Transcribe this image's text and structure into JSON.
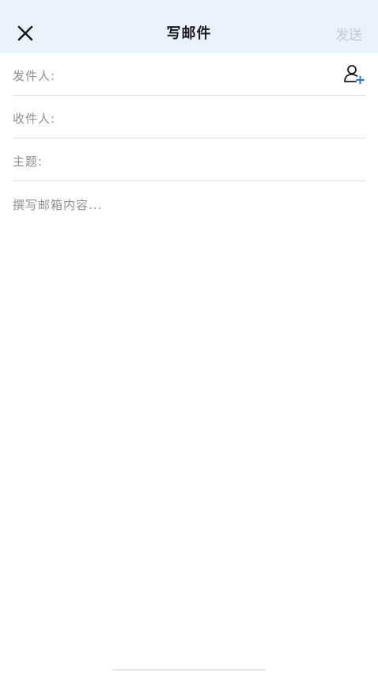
{
  "header": {
    "title": "写邮件",
    "send_label": "发送",
    "close_icon": "close-icon"
  },
  "fields": {
    "sender_label": "发件人:",
    "recipient_label": "收件人:",
    "subject_label": "主题:"
  },
  "body": {
    "placeholder": "撰写邮箱内容..."
  },
  "colors": {
    "header_bg": "#eaf2fc",
    "label": "#8f8f8f",
    "send_disabled": "#c4c8ce",
    "accent": "#1e7be6"
  }
}
